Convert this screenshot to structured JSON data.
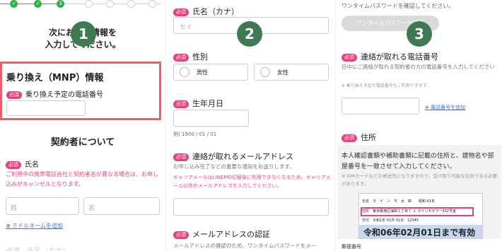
{
  "panel1": {
    "stepper": {
      "current": "3",
      "done_mark": "✓",
      "done_color": "#2db34a",
      "pending_color": "#d0d0d0"
    },
    "heading_line1": "次にお客様情報を",
    "heading_line2": "入力してください。",
    "step_number": "1",
    "mnp": {
      "title": "乗り換え（MNP）情報",
      "badge": "必須",
      "label": "乗り換え予定の電話番号"
    },
    "contract_title": "契約者について",
    "name": {
      "badge": "必須",
      "label": "氏名",
      "warning": "ご利用中の携帯電話会社と契約者名が異なる場合は、お申し込みがキャンセルとなります。",
      "sei_placeholder": "姓",
      "mei_placeholder": "名",
      "middle_link": "ミドルネームを追加"
    },
    "bottom_label": "必須　氏名（カナ）"
  },
  "panel2": {
    "step_number": "2",
    "kana": {
      "badge": "必須",
      "label": "氏名（カナ）",
      "placeholder": "セイ"
    },
    "gender": {
      "badge": "必須",
      "label": "性別",
      "male": "男性",
      "female": "女性"
    },
    "birthday": {
      "badge": "必須",
      "label": "生年月日",
      "hint": "例) 1900 / 01 / 01"
    },
    "email": {
      "badge": "必須",
      "label": "連絡が取れるメールアドレス",
      "desc": "お申し込み完了などの重要な通知をお送りします。",
      "note": "キャリアメールはLINEMO切替後に利用できなくなるため、キャリアメール以外のメールアドレスを入力してください。"
    },
    "email_verify": {
      "badge": "必須",
      "label": "メールアドレスの認証",
      "desc": "メールアドレスの確認のため、ワンタイムパスワードをメー"
    }
  },
  "panel3": {
    "step_number": "3",
    "top_text": "ワンタイムパスワードを確認してください。",
    "otp_button": "ワンタイムパスワード送信",
    "phone": {
      "badge": "必須",
      "label": "連絡が取れる電話番号",
      "desc": "日中にご連絡が取れる契約者の方の電話番号を入力してください",
      "small": "※ 乗り換え予定の電話番号もご利用できます。",
      "add_link": "電話番号を追加"
    },
    "address": {
      "badge": "必須",
      "label": "住所",
      "desc": "本人確認書類や補助書類に記載の住所と、建物名や部屋番号を一致させて入力してください。",
      "note": "※ SIMカードなどの発送先になりますので、受け取り可能な住所である必要があります。",
      "card": {
        "name_row": "氏名　ラ　イ　ン　モ　太　郎　　昭和 61年",
        "address_row": "住所　東京都港区海岸１丁目７-１ ラインモタワー502号室",
        "issue_row": "交付　令和1年 01月 01日　12345",
        "expiry": "令和06年02月01日まで有効"
      }
    },
    "postal_label": "郵便番号"
  },
  "colors": {
    "accent_pink": "#e8407e",
    "step_badge": "#3d7a4f",
    "highlight_box": "#f25c6a",
    "link_blue": "#3b6fd6"
  }
}
